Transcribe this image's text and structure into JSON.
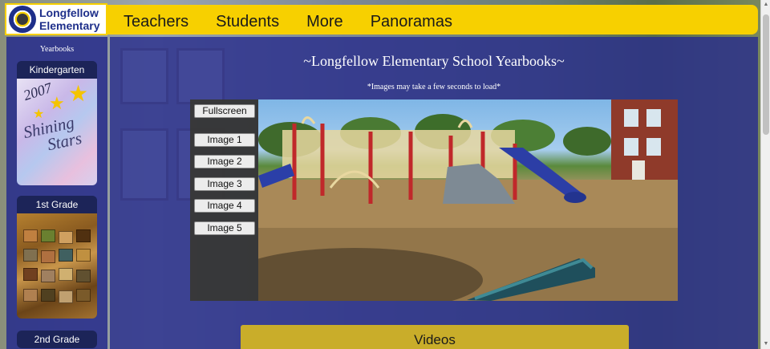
{
  "site": {
    "name_line1": "Longfellow",
    "name_line2": "Elementary"
  },
  "nav": {
    "items": [
      "Teachers",
      "Students",
      "More",
      "Panoramas"
    ]
  },
  "sidebar": {
    "title": "Yearbooks",
    "grades": [
      {
        "label": "Kindergarten",
        "cover_year": "2007",
        "cover_line1": "Shining",
        "cover_line2": "Stars"
      },
      {
        "label": "1st Grade"
      },
      {
        "label": "2nd Grade"
      }
    ]
  },
  "main": {
    "title": "~Longfellow Elementary School Yearbooks~",
    "note": "*Images may take a few seconds to load*"
  },
  "viewer": {
    "fullscreen_label": "Fullscreen",
    "image_buttons": [
      "Image 1",
      "Image 2",
      "Image 3",
      "Image 4",
      "Image 5"
    ]
  },
  "footer": {
    "videos_label": "Videos"
  },
  "colors": {
    "header_yellow": "#f7d000",
    "panel_blue": "#282d8c",
    "videos_gold": "#c9ad2a"
  }
}
